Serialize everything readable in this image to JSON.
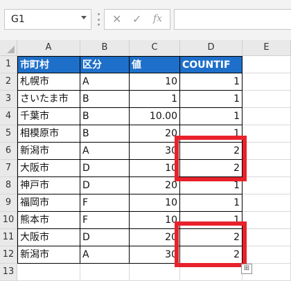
{
  "formula_bar": {
    "name_box": "G1",
    "cancel_icon": "✕",
    "enter_icon": "✓",
    "fx_label": "fx",
    "formula_value": ""
  },
  "columns": [
    "A",
    "B",
    "C",
    "D",
    "E"
  ],
  "row_numbers": [
    "1",
    "2",
    "3",
    "4",
    "5",
    "6",
    "7",
    "8",
    "9",
    "10",
    "11",
    "12",
    "13"
  ],
  "table": {
    "headers": [
      "市町村",
      "区分",
      "値",
      "COUNTIF"
    ],
    "rows": [
      [
        "札幌市",
        "A",
        "10",
        "1"
      ],
      [
        "さいたま市",
        "B",
        "1",
        "1"
      ],
      [
        "千葉市",
        "B",
        "10.00",
        "1"
      ],
      [
        "相模原市",
        "B",
        "20",
        "1"
      ],
      [
        "新潟市",
        "A",
        "30",
        "2"
      ],
      [
        "大阪市",
        "D",
        "10",
        "2"
      ],
      [
        "神戸市",
        "D",
        "20",
        "1"
      ],
      [
        "福岡市",
        "F",
        "10",
        "1"
      ],
      [
        "熊本市",
        "F",
        "10",
        "1"
      ],
      [
        "大阪市",
        "D",
        "20",
        "2"
      ],
      [
        "新潟市",
        "A",
        "30",
        "2"
      ]
    ]
  },
  "highlight_color": "#e8212b",
  "header_fill_color": "#1e6fc9",
  "quick_analysis_icon": "⊞"
}
